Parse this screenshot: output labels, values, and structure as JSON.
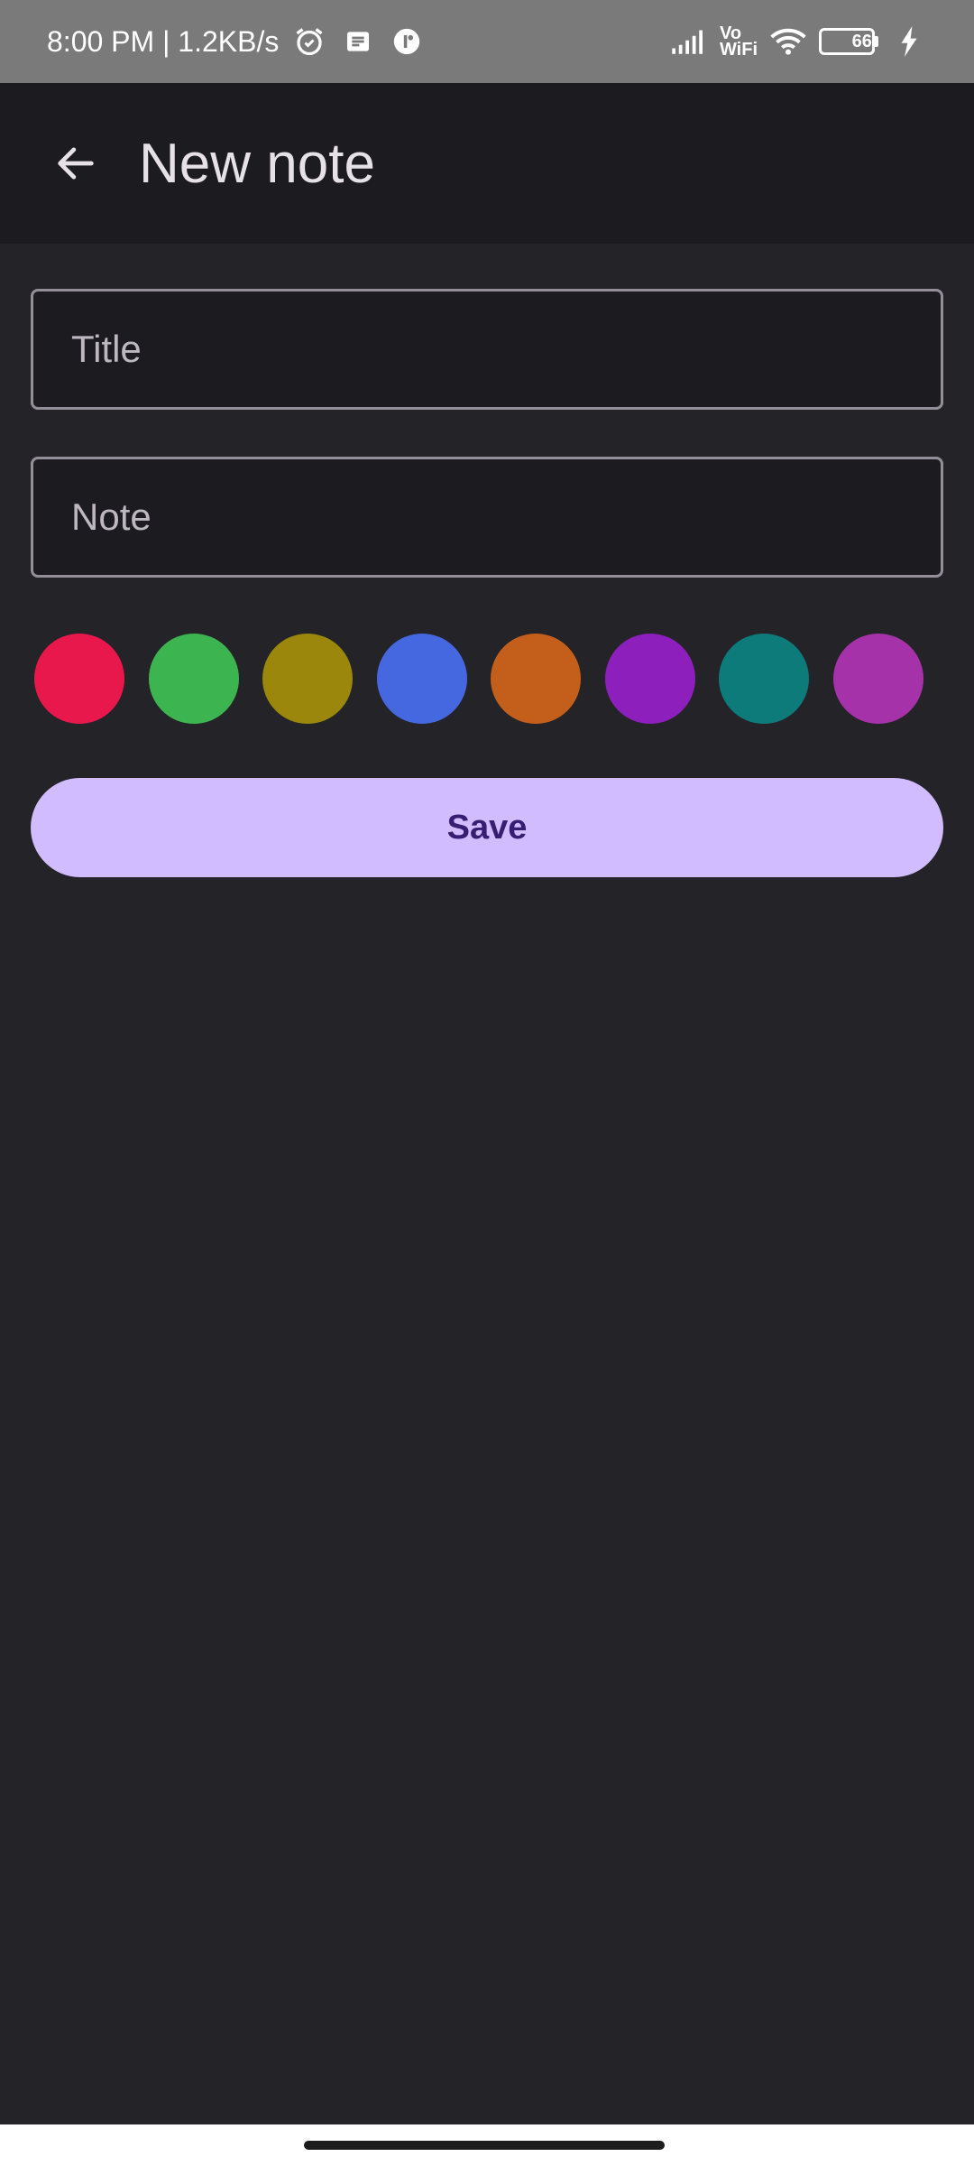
{
  "status_bar": {
    "time_speed": "8:00 PM | 1.2KB/s",
    "icons": [
      "alarm-icon",
      "message-icon",
      "app-notification-icon",
      "signal-icon",
      "vowifi-icon",
      "wifi-icon",
      "battery-icon",
      "charging-icon"
    ],
    "vowifi_top": "Vo",
    "vowifi_bottom": "WiFi",
    "battery_level": "66"
  },
  "app_bar": {
    "title": "New note",
    "back_icon": "arrow-back-icon"
  },
  "form": {
    "title_placeholder": "Title",
    "note_placeholder": "Note"
  },
  "color_options": [
    {
      "name": "red",
      "hex": "#e8184c"
    },
    {
      "name": "green",
      "hex": "#3cb551"
    },
    {
      "name": "olive",
      "hex": "#9a870b"
    },
    {
      "name": "blue",
      "hex": "#4567df"
    },
    {
      "name": "orange",
      "hex": "#c35f1a"
    },
    {
      "name": "purple",
      "hex": "#8d1fbd"
    },
    {
      "name": "teal",
      "hex": "#0e7b7b"
    },
    {
      "name": "magenta",
      "hex": "#a532a8"
    }
  ],
  "actions": {
    "save_label": "Save"
  },
  "theme": {
    "background": "#232328",
    "app_bar": "#1c1b20",
    "primary_container": "#d0bcff",
    "on_primary_container": "#381e72"
  }
}
